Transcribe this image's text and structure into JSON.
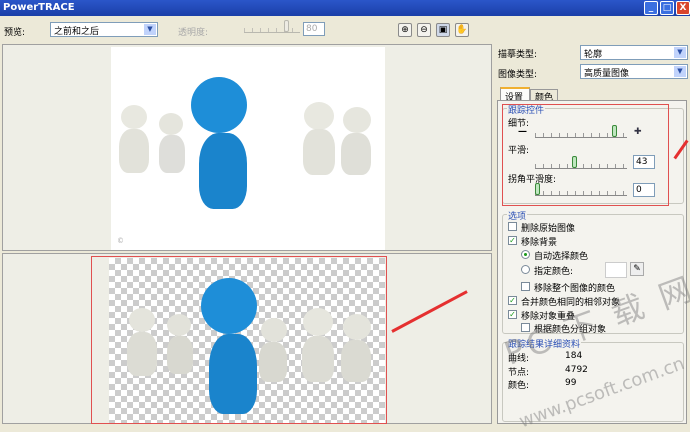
{
  "title": "PowerTRACE",
  "window_buttons": {
    "minimize": "_",
    "maximize": "□",
    "close": "X"
  },
  "toolbar": {
    "preview_label": "预览:",
    "preview_value": "之前和之后",
    "transparency_label": "透明度:",
    "transparency_value": "80"
  },
  "right": {
    "trace_type_label": "描摹类型:",
    "trace_type_value": "轮廓",
    "image_type_label": "图像类型:",
    "image_type_value": "高质量图像",
    "tabs": [
      "设置",
      "颜色"
    ],
    "trace_controls": {
      "title": "跟踪控件",
      "detail_label": "细节:",
      "smooth_label": "平滑:",
      "smooth_value": "43",
      "corner_label": "拐角平滑度:",
      "corner_value": "0",
      "detail_fraction": 0.9,
      "smooth_fraction": 0.43,
      "corner_fraction": 0
    },
    "options": {
      "title": "选项",
      "items": [
        {
          "label": "删除原始图像",
          "checked": false
        },
        {
          "label": "移除背景",
          "checked": true
        },
        {
          "label": "自动选择颜色",
          "radio": true,
          "selected": true
        },
        {
          "label": "指定颜色:",
          "radio": true,
          "selected": false
        },
        {
          "label": "移除整个图像的颜色",
          "checked": false
        },
        {
          "label": "合并颜色相同的相邻对象",
          "checked": true
        },
        {
          "label": "移除对象重叠",
          "checked": true
        },
        {
          "label": "根据颜色分组对象",
          "checked": false
        }
      ]
    },
    "results": {
      "title": "跟踪结果详细资料",
      "curves_label": "曲线:",
      "curves_value": "184",
      "nodes_label": "节点:",
      "nodes_value": "4792",
      "colors_label": "颜色:",
      "colors_value": "99"
    }
  },
  "watermark": {
    "line1": "PC 下 载 网",
    "line2": "www.pcsoft.com.cn"
  }
}
